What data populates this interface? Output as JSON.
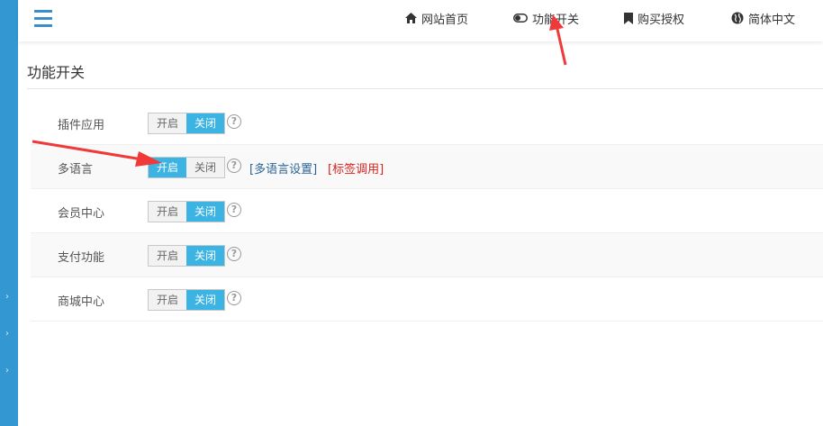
{
  "nav": {
    "home": "网站首页",
    "features": "功能开关",
    "license": "购买授权",
    "language": "简体中文"
  },
  "page": {
    "title": "功能开关"
  },
  "switch_labels": {
    "on": "开启",
    "off": "关闭"
  },
  "rows": [
    {
      "label": "插件应用",
      "enabled": false
    },
    {
      "label": "多语言",
      "enabled": true,
      "link1": "[多语言设置]",
      "link2": "[标签调用]"
    },
    {
      "label": "会员中心",
      "enabled": false
    },
    {
      "label": "支付功能",
      "enabled": false
    },
    {
      "label": "商城中心",
      "enabled": false
    }
  ],
  "help_glyph": "?",
  "colors": {
    "sidebar": "#3398d2",
    "switch_on": "#3bb4e3",
    "link_red": "#d9231d",
    "arrow": "#f03a3a"
  }
}
